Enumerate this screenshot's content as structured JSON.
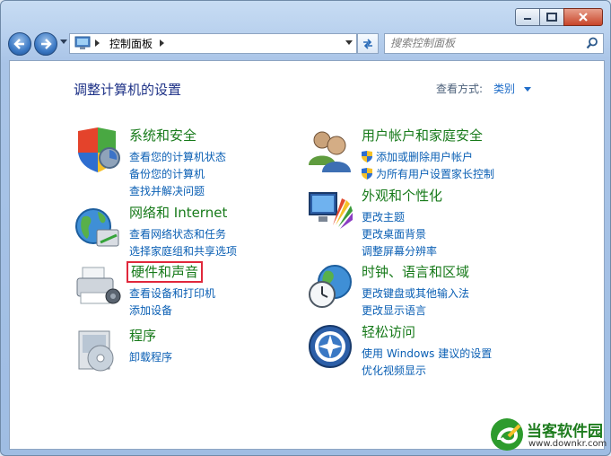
{
  "window": {
    "address_crumb": "控制面板",
    "search_placeholder": "搜索控制面板"
  },
  "main": {
    "heading": "调整计算机的设置",
    "view_by_label": "查看方式:",
    "view_by_value": "类别"
  },
  "categories": [
    {
      "title": "系统和安全",
      "links": [
        "查看您的计算机状态",
        "备份您的计算机",
        "查找并解决问题"
      ]
    },
    {
      "title": "网络和 Internet",
      "links": [
        "查看网络状态和任务",
        "选择家庭组和共享选项"
      ]
    },
    {
      "title": "硬件和声音",
      "links": [
        "查看设备和打印机",
        "添加设备"
      ]
    },
    {
      "title": "程序",
      "links": [
        "卸载程序"
      ]
    },
    {
      "title": "用户帐户和家庭安全",
      "links": [
        "添加或删除用户帐户",
        "为所有用户设置家长控制"
      ]
    },
    {
      "title": "外观和个性化",
      "links": [
        "更改主题",
        "更改桌面背景",
        "调整屏幕分辨率"
      ]
    },
    {
      "title": "时钟、语言和区域",
      "links": [
        "更改键盘或其他输入法",
        "更改显示语言"
      ]
    },
    {
      "title": "轻松访问",
      "links": [
        "使用 Windows 建议的设置",
        "优化视频显示"
      ]
    }
  ],
  "watermark": {
    "name": "当客软件园",
    "url": "www.downkr.com"
  },
  "colors": {
    "category_title": "#177a1a",
    "link": "#0a5fb4",
    "highlight_box": "#e0283b"
  }
}
